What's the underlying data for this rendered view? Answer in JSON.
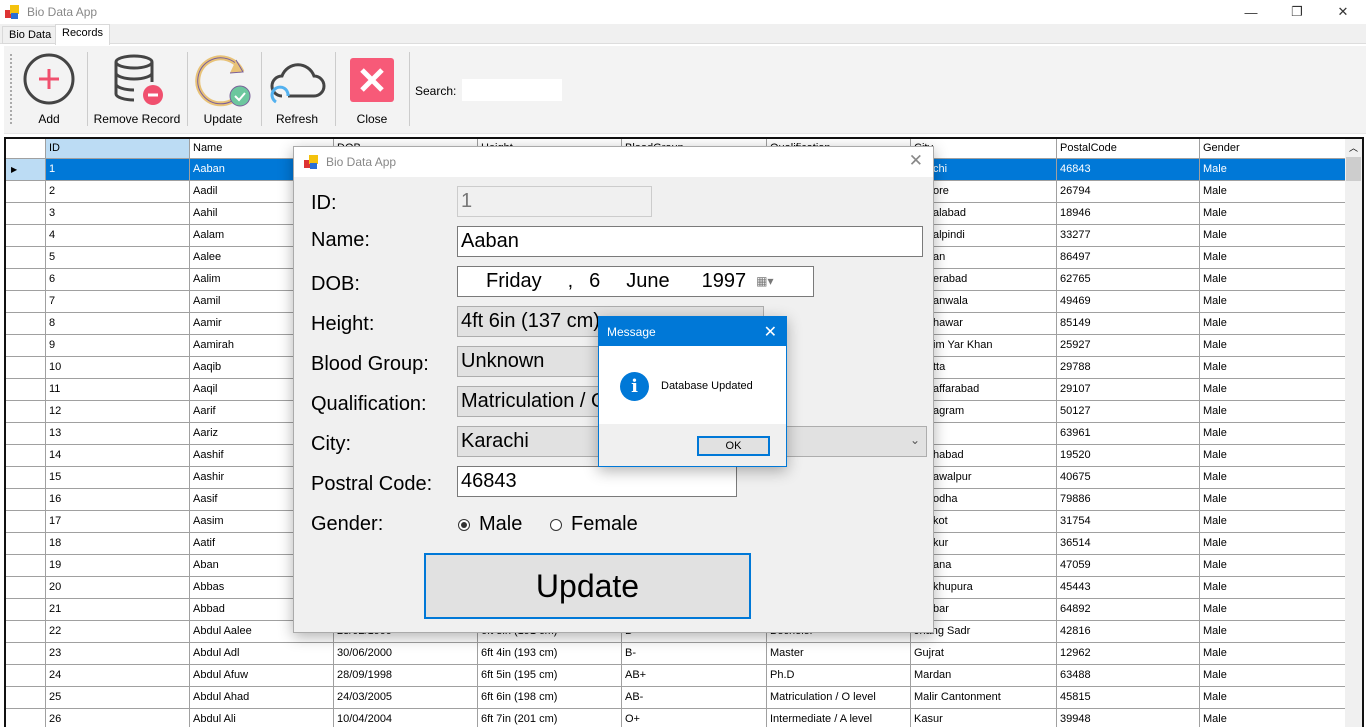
{
  "window": {
    "title": "Bio Data App",
    "controls": [
      "—",
      "❐",
      "✕"
    ]
  },
  "tabs": [
    {
      "label": "Bio Data"
    },
    {
      "label": "Records",
      "active": true
    }
  ],
  "toolbar": {
    "add": "Add",
    "remove": "Remove Record",
    "update": "Update",
    "refresh": "Refresh",
    "close": "Close",
    "search_label": "Search:",
    "search_value": ""
  },
  "grid": {
    "columns": [
      "ID",
      "Name",
      "DOB",
      "Height",
      "BloodGroup",
      "Qualification",
      "City",
      "PostalCode",
      "Gender"
    ],
    "rows": [
      [
        "1",
        "Aaban",
        "",
        "",
        "",
        "",
        "chi",
        "46843",
        "Male"
      ],
      [
        "2",
        "Aadil",
        "",
        "",
        "",
        "",
        "ore",
        "26794",
        "Male"
      ],
      [
        "3",
        "Aahil",
        "",
        "",
        "",
        "",
        "alabad",
        "18946",
        "Male"
      ],
      [
        "4",
        "Aalam",
        "",
        "",
        "",
        "",
        "alpindi",
        "33277",
        "Male"
      ],
      [
        "5",
        "Aalee",
        "",
        "",
        "",
        "",
        "an",
        "86497",
        "Male"
      ],
      [
        "6",
        "Aalim",
        "",
        "",
        "",
        "",
        "erabad",
        "62765",
        "Male"
      ],
      [
        "7",
        "Aamil",
        "",
        "",
        "",
        "",
        "anwala",
        "49469",
        "Male"
      ],
      [
        "8",
        "Aamir",
        "",
        "",
        "",
        "",
        "hawar",
        "85149",
        "Male"
      ],
      [
        "9",
        "Aamirah",
        "",
        "",
        "",
        "",
        "im Yar Khan",
        "25927",
        "Male"
      ],
      [
        "10",
        "Aaqib",
        "",
        "",
        "",
        "",
        "tta",
        "29788",
        "Male"
      ],
      [
        "11",
        "Aaqil",
        "",
        "",
        "",
        "",
        "affarabad",
        "29107",
        "Male"
      ],
      [
        "12",
        "Aarif",
        "",
        "",
        "",
        "",
        "agram",
        "50127",
        "Male"
      ],
      [
        "13",
        "Aariz",
        "",
        "",
        "",
        "",
        "",
        "63961",
        "Male"
      ],
      [
        "14",
        "Aashif",
        "",
        "",
        "",
        "",
        "habad",
        "19520",
        "Male"
      ],
      [
        "15",
        "Aashir",
        "",
        "",
        "",
        "",
        "awalpur",
        "40675",
        "Male"
      ],
      [
        "16",
        "Aasif",
        "",
        "",
        "",
        "",
        "odha",
        "79886",
        "Male"
      ],
      [
        "17",
        "Aasim",
        "",
        "",
        "",
        "",
        "kot",
        "31754",
        "Male"
      ],
      [
        "18",
        "Aatif",
        "",
        "",
        "",
        "",
        "kur",
        "36514",
        "Male"
      ],
      [
        "19",
        "Aban",
        "",
        "",
        "",
        "",
        "ana",
        "47059",
        "Male"
      ],
      [
        "20",
        "Abbas",
        "",
        "",
        "",
        "",
        "khupura",
        "45443",
        "Male"
      ],
      [
        "21",
        "Abbad",
        "",
        "",
        "",
        "",
        "bar",
        "64892",
        "Male"
      ],
      [
        "22",
        "Abdul Aalee",
        "23/02/1999",
        "6ft 3in (191 cm)",
        "B+",
        "Bechelor",
        "Jhang Sadr",
        "42816",
        "Male"
      ],
      [
        "23",
        "Abdul Adl",
        "30/06/2000",
        "6ft 4in (193 cm)",
        "B-",
        "Master",
        "Gujrat",
        "12962",
        "Male"
      ],
      [
        "24",
        "Abdul Afuw",
        "28/09/1998",
        "6ft 5in (195 cm)",
        "AB+",
        "Ph.D",
        "Mardan",
        "63488",
        "Male"
      ],
      [
        "25",
        "Abdul Ahad",
        "24/03/2005",
        "6ft 6in (198 cm)",
        "AB-",
        "Matriculation / O level",
        "Malir Cantonment",
        "45815",
        "Male"
      ],
      [
        "26",
        "Abdul Ali",
        "10/04/2004",
        "6ft 7in (201 cm)",
        "O+",
        "Intermediate / A level",
        "Kasur",
        "39948",
        "Male"
      ]
    ]
  },
  "dialog": {
    "title": "Bio Data App",
    "id_label": "ID:",
    "id_value": "1",
    "name_label": "Name:",
    "name_value": "Aaban",
    "dob_label": "DOB:",
    "dob_day": "Friday",
    "dob_sep": ",",
    "dob_date": "6",
    "dob_month": "June",
    "dob_year": "1997",
    "height_label": "Height:",
    "height_value": "4ft 6in (137 cm)",
    "blood_label": "Blood Group:",
    "blood_value": "Unknown",
    "qual_label": "Qualification:",
    "qual_value": "Matriculation / O level",
    "city_label": "City:",
    "city_value": "Karachi",
    "postal_label": "Postral Code:",
    "postal_value": "46843",
    "gender_label": "Gender:",
    "male": "Male",
    "female": "Female",
    "gender_selected": "Male",
    "update_button": "Update"
  },
  "message": {
    "title": "Message",
    "text": "Database Updated",
    "ok": "OK"
  }
}
